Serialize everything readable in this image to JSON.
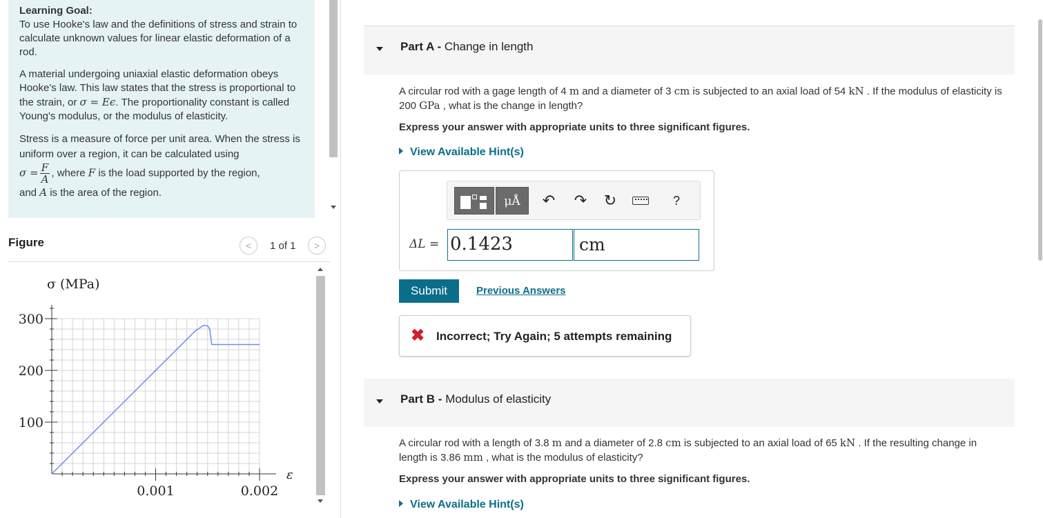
{
  "learning_goal": {
    "heading": "Learning Goal:",
    "intro": "To use Hooke's law and the definitions of stress and strain to calculate unknown values for linear elastic deformation of a rod.",
    "p2_a": "A material undergoing uniaxial elastic deformation obeys Hooke's law. This law states that the stress is proportional to the strain, or ",
    "p2_eq": "σ = Eϵ",
    "p2_b": ". The proportionality constant is called Young's modulus, or the modulus of elasticity.",
    "p3_a": "Stress is a measure of force per unit area. When the stress is uniform over a region, it can be calculated using",
    "p3_sigma": "σ =",
    "p3_num": "F",
    "p3_den": "A",
    "p3_b": ", where ",
    "p3_F": "F",
    "p3_c": " is the load supported by the region,",
    "p3_d": "and ",
    "p3_A": "A",
    "p3_e": " is the area of the region."
  },
  "figure": {
    "title": "Figure",
    "page_indicator": "1 of 1",
    "prev_symbol": "<",
    "next_symbol": ">"
  },
  "chart_data": {
    "type": "line",
    "ylabel": "σ (MPa)",
    "xlabel": "ε",
    "xlim": [
      0,
      0.00205
    ],
    "ylim": [
      0,
      300
    ],
    "xticks": [
      0.001,
      0.002
    ],
    "xtick_labels": [
      "0.001",
      "0.002"
    ],
    "yticks": [
      100,
      200,
      300
    ],
    "ytick_labels": [
      "100",
      "200",
      "300"
    ],
    "grid": true,
    "series": [
      {
        "x": [
          0,
          0.00138,
          0.00146,
          0.0015,
          0.00152,
          0.00154,
          0.002
        ],
        "y": [
          0,
          276,
          287,
          286,
          280,
          250,
          250
        ]
      }
    ],
    "line_color": "#6b8cf0"
  },
  "partA": {
    "label": "Part A - ",
    "title": "Change in length",
    "q_1": "A circular rod with a gage length of 4 ",
    "q_m": "m",
    "q_2": " and a diameter of 3 ",
    "q_cm": "cm",
    "q_3": " is subjected to an axial load of 54 ",
    "q_kN": "kN",
    "q_4": " . If the modulus of elasticity is 200 ",
    "q_GPa": "GPa",
    "q_5": " , what is the change in length?",
    "instructions": "Express your answer with appropriate units to three significant figures.",
    "hint": "View Available Hint(s)",
    "eq_label": "ΔL =",
    "value": "0.1423",
    "unit": "cm",
    "submit": "Submit",
    "previous_answers": "Previous Answers",
    "feedback": "Incorrect; Try Again; 5 attempts remaining",
    "feedback_icon": "✖"
  },
  "toolbar": {
    "units_label": "μÅ",
    "undo_glyph": "↶",
    "redo_glyph": "↷",
    "reset_glyph": "↻",
    "help": "?"
  },
  "partB": {
    "label": "Part B - ",
    "title": "Modulus of elasticity",
    "q_1": "A circular rod with a length of 3.8 ",
    "q_m": "m",
    "q_2": " and a diameter of 2.8 ",
    "q_cm": "cm",
    "q_3": " is subjected to an axial load of 65 ",
    "q_kN": "kN",
    "q_4": " . If the resulting change in length is 3.86 ",
    "q_mm": "mm",
    "q_5": " , what is the modulus of elasticity?",
    "instructions": "Express your answer with appropriate units to three significant figures.",
    "hint": "View Available Hint(s)"
  }
}
